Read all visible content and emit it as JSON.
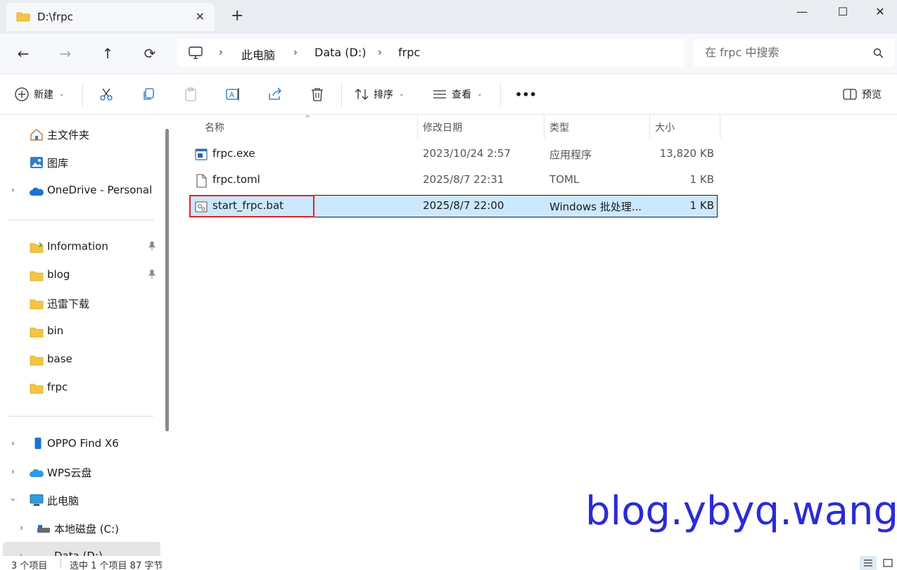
{
  "tab": {
    "title": "D:\\frpc",
    "close_glyph": "✕",
    "new_tab_glyph": "+"
  },
  "window_controls": {
    "minimize": "—",
    "maximize": "☐",
    "close": "✕"
  },
  "nav": {
    "back": "←",
    "forward": "→",
    "up": "↑",
    "refresh": "⟳"
  },
  "breadcrumb": [
    "此电脑",
    "Data (D:)",
    "frpc"
  ],
  "breadcrumb_sep": "›",
  "search": {
    "placeholder": "在 frpc 中搜索"
  },
  "commands": {
    "new_label": "新建",
    "sort_label": "排序",
    "view_label": "查看",
    "more_label": "•••",
    "preview_label": "预览",
    "caret": "⌄"
  },
  "sidebar": {
    "items": [
      {
        "label": "主文件夹",
        "icon": "home-icon"
      },
      {
        "label": "图库",
        "icon": "gallery-icon"
      },
      {
        "label": "OneDrive - Personal",
        "icon": "onedrive-icon"
      },
      {
        "label": "Information",
        "icon": "folder-icon"
      },
      {
        "label": "blog",
        "icon": "folder-icon"
      },
      {
        "label": "迅雷下载",
        "icon": "folder-icon"
      },
      {
        "label": "bin",
        "icon": "folder-icon"
      },
      {
        "label": "base",
        "icon": "folder-icon"
      },
      {
        "label": "frpc",
        "icon": "folder-icon"
      },
      {
        "label": "OPPO Find X6",
        "icon": "phone-icon"
      },
      {
        "label": "WPS云盘",
        "icon": "cloud-icon"
      },
      {
        "label": "此电脑",
        "icon": "pc-icon"
      },
      {
        "label": "本地磁盘 (C:)",
        "icon": "drive-icon"
      },
      {
        "label": "Data (D:)",
        "icon": "drive-icon"
      }
    ]
  },
  "columns": {
    "name": "名称",
    "date": "修改日期",
    "type": "类型",
    "size": "大小"
  },
  "files": [
    {
      "name": "frpc.exe",
      "date": "2023/10/24 2:57",
      "type": "应用程序",
      "size": "13,820 KB",
      "icon": "exe-icon"
    },
    {
      "name": "frpc.toml",
      "date": "2025/8/7 22:31",
      "type": "TOML",
      "size": "1 KB",
      "icon": "file-icon"
    },
    {
      "name": "start_frpc.bat",
      "date": "2025/8/7 22:00",
      "type": "Windows 批处理...",
      "size": "1 KB",
      "icon": "bat-icon",
      "selected": true
    }
  ],
  "watermark": "blog.ybyq.wang",
  "status": {
    "count": "3 个项目",
    "selection": "选中 1 个项目 87 字节"
  },
  "colors": {
    "accent": "#0067c0",
    "selection_bg": "#cce8ff",
    "highlight_box": "#e02424",
    "watermark": "#2b2bd6",
    "folder": "#f2c94c"
  }
}
